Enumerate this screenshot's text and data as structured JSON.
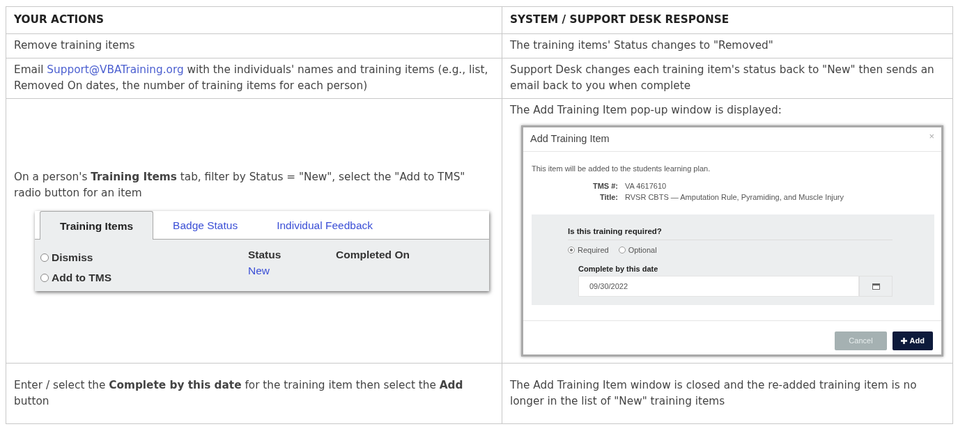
{
  "table": {
    "columns": [
      "YOUR ACTIONS",
      "SYSTEM / SUPPORT DESK RESPONSE"
    ],
    "rows": [
      {
        "action": {
          "text": "Remove training items"
        },
        "response": {
          "text": "The training items' Status changes to \"Removed\""
        }
      },
      {
        "action": {
          "before": "Email",
          "link": "Support@VBATraining.org",
          "after": "with the individuals' names and training items (e.g., list, Removed On dates, the number of training items for each person)"
        },
        "response": {
          "text": "Support Desk changes each training item's status back to \"New\" then sends an email back to you when complete"
        }
      },
      {
        "action": {
          "text": "On a person's **Training Items** tab, filter by Status = \"New\", select the \"Add to TMS\" radio button for an item",
          "tabs_panel": {
            "tabs": [
              {
                "label": "Training Items",
                "selected": true
              },
              {
                "label": "Badge Status",
                "selected": false
              },
              {
                "label": "Individual Feedback",
                "selected": false
              }
            ],
            "radios": [
              {
                "label": "Dismiss",
                "checked": false
              },
              {
                "label": "Add to TMS",
                "checked": false
              }
            ],
            "columns": [
              {
                "header": "Status",
                "value": "New"
              },
              {
                "header": "Completed On"
              }
            ]
          }
        },
        "response": {
          "text": "The Add Training Item pop-up window is displayed:",
          "dialog": {
            "title": "Add Training Item",
            "close": "×",
            "intro": "This item will be added to the students learning plan.",
            "fields": [
              {
                "label": "TMS #:",
                "value": "VA 4617610"
              },
              {
                "label": "Title:",
                "value": "RVSR CBTS — Amputation Rule, Pyramiding, and Muscle Injury"
              }
            ],
            "question": "Is this training required?",
            "options": [
              {
                "label": "Required",
                "selected": true
              },
              {
                "label": "Optional",
                "selected": false
              }
            ],
            "date_label": "Complete by this date",
            "date_value": "09/30/2022",
            "buttons": [
              {
                "label": "Cancel",
                "kind": "secondary"
              },
              {
                "label": "Add",
                "kind": "primary"
              }
            ]
          }
        }
      },
      {
        "action": {
          "text": "Enter / select the **Complete by this date** for the training item then select the **Add** button"
        },
        "response": {
          "text": "The Add Training Item window is closed and the re-added training item is no longer in the list of \"New\" training items"
        }
      }
    ]
  }
}
